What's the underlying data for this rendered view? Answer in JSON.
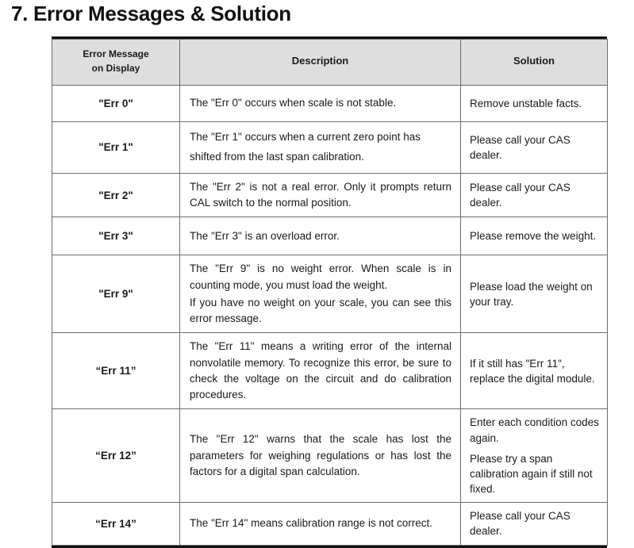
{
  "document": {
    "title": "7. Error Messages & Solution"
  },
  "table": {
    "headers": {
      "code_line1": "Error Message",
      "code_line2": "on Display",
      "description": "Description",
      "solution": "Solution"
    },
    "rows": [
      {
        "code": "\"Err 0\"",
        "description": [
          "The \"Err 0\" occurs when scale is not stable."
        ],
        "solution": [
          "Remove unstable facts."
        ]
      },
      {
        "code": "\"Err 1\"",
        "description": [
          "The \"Err 1\" occurs when a current zero point has shifted from the last span calibration."
        ],
        "solution": [
          "Please call your CAS dealer."
        ]
      },
      {
        "code": "\"Err 2\"",
        "description": [
          "The \"Err 2\" is not a real error. Only it prompts return CAL switch to the normal position."
        ],
        "solution": [
          "Please call your CAS dealer."
        ]
      },
      {
        "code": "\"Err 3\"",
        "description": [
          "The \"Err 3\" is an overload error."
        ],
        "solution": [
          "Please remove the weight."
        ]
      },
      {
        "code": "\"Err 9\"",
        "description": [
          "The \"Err 9\" is no weight error. When scale is in counting mode, you must load the weight.",
          "If you have no weight on your scale, you can see this error message."
        ],
        "solution": [
          "Please load the weight on your tray."
        ]
      },
      {
        "code": "“Err 11”",
        "description": [
          "The \"Err 11\" means a writing error of the internal nonvolatile memory. To recognize this error, be sure to check the voltage on the circuit and do calibration procedures."
        ],
        "solution": [
          "If it still has \"Err 11\", replace the digital module."
        ]
      },
      {
        "code": "“Err 12”",
        "description": [
          "The \"Err 12\" warns that the scale has lost the parameters for weighing regulations or has lost the factors for a digital span calculation."
        ],
        "solution": [
          "Enter each condition codes again.",
          "Please try a span calibration again if still not fixed."
        ]
      },
      {
        "code": "“Err 14”",
        "description": [
          "The \"Err 14\" means calibration range is not correct."
        ],
        "solution": [
          "Please call your CAS dealer."
        ]
      }
    ]
  },
  "colors": {
    "header_background": "#dedede",
    "border": "#6d6d6d",
    "outer_border": "#111111",
    "text": "#1a1a1a",
    "page_background": "#ffffff"
  }
}
